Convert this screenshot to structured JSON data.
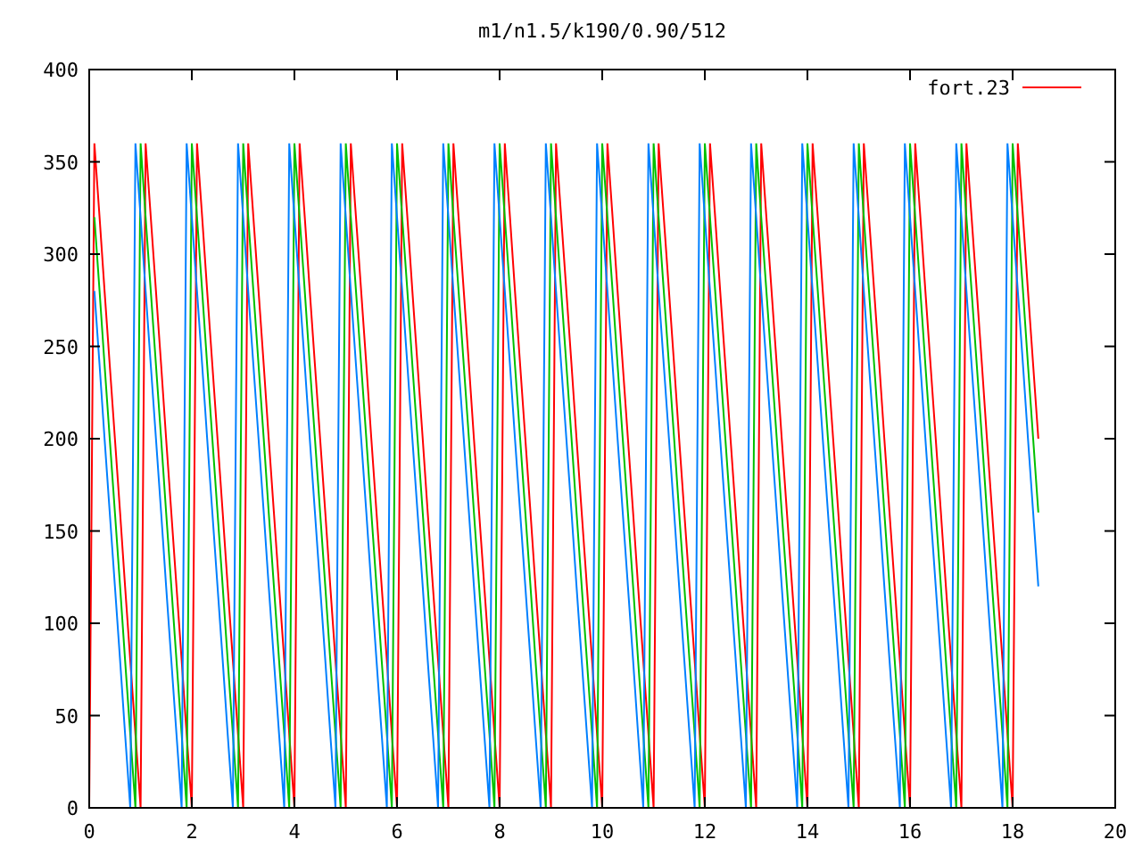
{
  "plot": {
    "chart_data": {
      "type": "line",
      "title": "m1/n1.5/k190/0.90/512",
      "xlim": [
        0,
        20
      ],
      "ylim": [
        0,
        400
      ],
      "xticks": [
        0,
        2,
        4,
        6,
        8,
        10,
        12,
        14,
        16,
        18,
        20
      ],
      "yticks": [
        0,
        50,
        100,
        150,
        200,
        250,
        300,
        350,
        400
      ],
      "x": [
        0,
        0.1,
        0.2,
        0.3,
        0.4,
        0.5,
        0.6,
        0.7,
        0.8,
        0.9,
        1,
        1.1,
        1.2,
        1.3,
        1.4,
        1.5,
        1.6,
        1.7,
        1.8,
        1.9,
        2,
        2.1,
        2.2,
        2.3,
        2.4,
        2.5,
        2.6,
        2.7,
        2.8,
        2.9,
        3,
        3.1,
        3.2,
        3.3,
        3.4,
        3.5,
        3.6,
        3.7,
        3.8,
        3.9,
        4,
        4.1,
        4.2,
        4.3,
        4.4,
        4.5,
        4.6,
        4.7,
        4.8,
        4.9,
        5,
        5.1,
        5.2,
        5.3,
        5.4,
        5.5,
        5.6,
        5.7,
        5.8,
        5.9,
        6,
        6.1,
        6.2,
        6.3,
        6.4,
        6.5,
        6.6,
        6.7,
        6.8,
        6.9,
        7,
        7.1,
        7.2,
        7.3,
        7.4,
        7.5,
        7.6,
        7.7,
        7.8,
        7.9,
        8,
        8.1,
        8.2,
        8.3,
        8.4,
        8.5,
        8.6,
        8.7,
        8.8,
        8.9,
        9,
        9.1,
        9.2,
        9.3,
        9.4,
        9.5,
        9.6,
        9.7,
        9.8,
        9.9,
        10,
        10.1,
        10.2,
        10.3,
        10.4,
        10.5,
        10.6,
        10.7,
        10.8,
        10.9,
        11,
        11.1,
        11.2,
        11.3,
        11.4,
        11.5,
        11.6,
        11.7,
        11.8,
        11.9,
        12,
        12.1,
        12.2,
        12.3,
        12.4,
        12.5,
        12.6,
        12.7,
        12.8,
        12.9,
        13,
        13.1,
        13.2,
        13.3,
        13.4,
        13.5,
        13.6,
        13.7,
        13.8,
        13.9,
        14,
        14.1,
        14.2,
        14.3,
        14.4,
        14.5,
        14.6,
        14.7,
        14.8,
        14.9,
        15,
        15.1,
        15.2,
        15.3,
        15.4,
        15.5,
        15.6,
        15.7,
        15.8,
        15.9,
        16,
        16.1,
        16.2,
        16.3,
        16.4,
        16.5,
        16.6,
        16.7,
        16.8,
        16.9,
        17,
        17.1,
        17.2,
        17.3,
        17.4,
        17.5,
        17.6,
        17.7,
        17.8,
        17.9,
        18,
        18.1,
        18.2,
        18.3,
        18.4,
        18.5
      ],
      "series": [
        {
          "name": "fort.23",
          "color": "#ff0000",
          "values": [
            0,
            360,
            320,
            280,
            240,
            200,
            160,
            120,
            80,
            40,
            0,
            360,
            320,
            280,
            240,
            200,
            160,
            120,
            80,
            40,
            0,
            360,
            320,
            280,
            240,
            200,
            160,
            120,
            80,
            40,
            0,
            360,
            320,
            280,
            240,
            200,
            160,
            120,
            80,
            40,
            0,
            360,
            320,
            280,
            240,
            200,
            160,
            120,
            80,
            40,
            0,
            360,
            320,
            280,
            240,
            200,
            160,
            120,
            80,
            40,
            0,
            360,
            320,
            280,
            240,
            200,
            160,
            120,
            80,
            40,
            0,
            360,
            320,
            280,
            240,
            200,
            160,
            120,
            80,
            40,
            0,
            360,
            320,
            280,
            240,
            200,
            160,
            120,
            80,
            40,
            0,
            360,
            320,
            280,
            240,
            200,
            160,
            120,
            80,
            40,
            0,
            360,
            320,
            280,
            240,
            200,
            160,
            120,
            80,
            40,
            0,
            360,
            320,
            280,
            240,
            200,
            160,
            120,
            80,
            40,
            0,
            360,
            320,
            280,
            240,
            200,
            160,
            120,
            80,
            40,
            0,
            360,
            320,
            280,
            240,
            200,
            160,
            120,
            80,
            40,
            0,
            360,
            320,
            280,
            240,
            200,
            160,
            120,
            80,
            40,
            0,
            360,
            320,
            280,
            240,
            200,
            160,
            120,
            80,
            40,
            0,
            360,
            320,
            280,
            240,
            200,
            160,
            120,
            80,
            40,
            0,
            360,
            320,
            280,
            240,
            200,
            160,
            120,
            80,
            40,
            0,
            360,
            320,
            280,
            240,
            200
          ]
        },
        {
          "color": "#00c000",
          "values": [
            null,
            320,
            280,
            240,
            200,
            160,
            120,
            80,
            40,
            0,
            360,
            320,
            280,
            240,
            200,
            160,
            120,
            80,
            40,
            0,
            360,
            320,
            280,
            240,
            200,
            160,
            120,
            80,
            40,
            0,
            360,
            320,
            280,
            240,
            200,
            160,
            120,
            80,
            40,
            0,
            360,
            320,
            280,
            240,
            200,
            160,
            120,
            80,
            40,
            0,
            360,
            320,
            280,
            240,
            200,
            160,
            120,
            80,
            40,
            0,
            360,
            320,
            280,
            240,
            200,
            160,
            120,
            80,
            40,
            0,
            360,
            320,
            280,
            240,
            200,
            160,
            120,
            80,
            40,
            0,
            360,
            320,
            280,
            240,
            200,
            160,
            120,
            80,
            40,
            0,
            360,
            320,
            280,
            240,
            200,
            160,
            120,
            80,
            40,
            0,
            360,
            320,
            280,
            240,
            200,
            160,
            120,
            80,
            40,
            0,
            360,
            320,
            280,
            240,
            200,
            160,
            120,
            80,
            40,
            0,
            360,
            320,
            280,
            240,
            200,
            160,
            120,
            80,
            40,
            0,
            360,
            320,
            280,
            240,
            200,
            160,
            120,
            80,
            40,
            0,
            360,
            320,
            280,
            240,
            200,
            160,
            120,
            80,
            40,
            0,
            360,
            320,
            280,
            240,
            200,
            160,
            120,
            80,
            40,
            0,
            360,
            320,
            280,
            240,
            200,
            160,
            120,
            80,
            40,
            0,
            360,
            320,
            280,
            240,
            200,
            160,
            120,
            80,
            40,
            0,
            360,
            320,
            280,
            240,
            200,
            160
          ]
        },
        {
          "color": "#0080ff",
          "values": [
            null,
            280,
            240,
            200,
            160,
            120,
            80,
            40,
            0,
            360,
            320,
            280,
            240,
            200,
            160,
            120,
            80,
            40,
            0,
            360,
            320,
            280,
            240,
            200,
            160,
            120,
            80,
            40,
            0,
            360,
            320,
            280,
            240,
            200,
            160,
            120,
            80,
            40,
            0,
            360,
            320,
            280,
            240,
            200,
            160,
            120,
            80,
            40,
            0,
            360,
            320,
            280,
            240,
            200,
            160,
            120,
            80,
            40,
            0,
            360,
            320,
            280,
            240,
            200,
            160,
            120,
            80,
            40,
            0,
            360,
            320,
            280,
            240,
            200,
            160,
            120,
            80,
            40,
            0,
            360,
            320,
            280,
            240,
            200,
            160,
            120,
            80,
            40,
            0,
            360,
            320,
            280,
            240,
            200,
            160,
            120,
            80,
            40,
            0,
            360,
            320,
            280,
            240,
            200,
            160,
            120,
            80,
            40,
            0,
            360,
            320,
            280,
            240,
            200,
            160,
            120,
            80,
            40,
            0,
            360,
            320,
            280,
            240,
            200,
            160,
            120,
            80,
            40,
            0,
            360,
            320,
            280,
            240,
            200,
            160,
            120,
            80,
            40,
            0,
            360,
            320,
            280,
            240,
            200,
            160,
            120,
            80,
            40,
            0,
            360,
            320,
            280,
            240,
            200,
            160,
            120,
            80,
            40,
            0,
            360,
            320,
            280,
            240,
            200,
            160,
            120,
            80,
            40,
            0,
            360,
            320,
            280,
            240,
            200,
            160,
            120,
            80,
            40,
            0,
            360,
            320,
            280,
            240,
            200,
            160,
            120
          ]
        }
      ]
    }
  }
}
